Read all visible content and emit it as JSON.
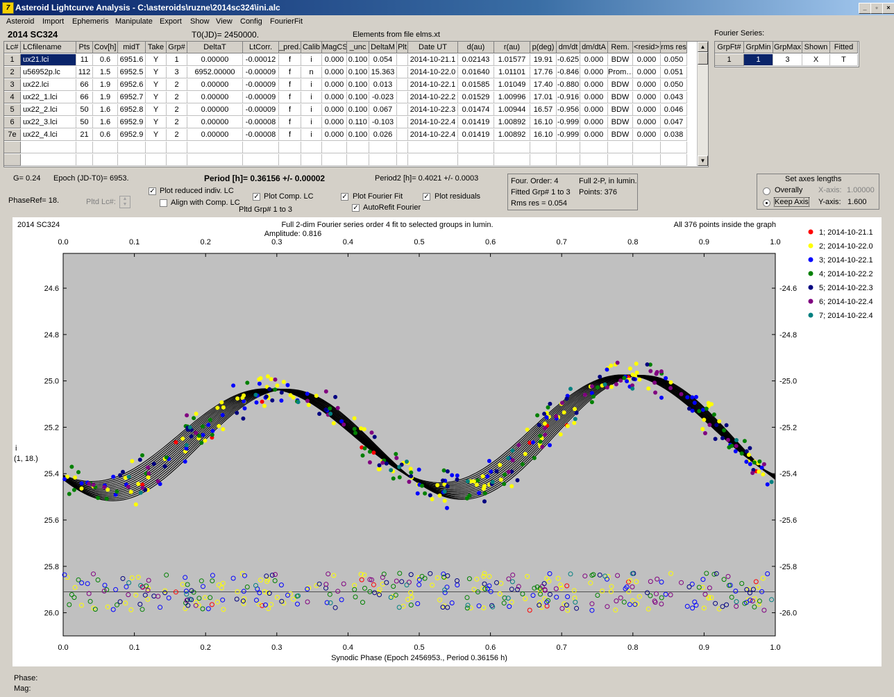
{
  "window": {
    "title": "Asteroid Lightcurve Analysis - C:\\asteroids\\ruzne\\2014sc324\\ini.alc",
    "icon": "app-icon",
    "min": "_",
    "max": "▫",
    "close": "×"
  },
  "menu": [
    "Asteroid",
    "Import",
    "Ephemeris",
    "Manipulate",
    "Export",
    "Show",
    "View",
    "Config",
    "FourierFit"
  ],
  "header": {
    "asteroid": "2014 SC324",
    "t0": "T0(JD)= 2450000.",
    "elements": "Elements from file elms.xt"
  },
  "table": {
    "columns": [
      "Lc#",
      "LCfilename",
      "Pts",
      "Cov[h]",
      "midT",
      "Take",
      "Grp#",
      "DeltaT",
      "LtCorr.",
      "_pred.",
      "Calib",
      "MagCS",
      "_unc",
      "DeltaM",
      "Plt",
      "Date UT",
      "d(au)",
      "r(au)",
      "p(deg)",
      "dm/dt",
      "dm/dtA",
      "Rem.",
      "<resid>",
      "rms res"
    ],
    "rows": [
      [
        "1",
        "ux21.lci",
        "11",
        "0.6",
        "6951.6",
        "Y",
        "1",
        "0.00000",
        "-0.00012",
        "f",
        "i",
        "0.000",
        "0.100",
        "0.054",
        "",
        "2014-10-21.1",
        "0.02143",
        "1.01577",
        "19.91",
        "-0.625",
        "0.000",
        "BDW",
        "0.000",
        "0.050"
      ],
      [
        "2",
        "u56952p.lc",
        "112",
        "1.5",
        "6952.5",
        "Y",
        "3",
        "6952.00000",
        "-0.00009",
        "f",
        "n",
        "0.000",
        "0.100",
        "15.363",
        "",
        "2014-10-22.0",
        "0.01640",
        "1.01101",
        "17.76",
        "-0.846",
        "0.000",
        "Prom…",
        "0.000",
        "0.051"
      ],
      [
        "3",
        "ux22.lci",
        "66",
        "1.9",
        "6952.6",
        "Y",
        "2",
        "0.00000",
        "-0.00009",
        "f",
        "i",
        "0.000",
        "0.100",
        "0.013",
        "",
        "2014-10-22.1",
        "0.01585",
        "1.01049",
        "17.40",
        "-0.880",
        "0.000",
        "BDW",
        "0.000",
        "0.050"
      ],
      [
        "4",
        "ux22_1.lci",
        "66",
        "1.9",
        "6952.7",
        "Y",
        "2",
        "0.00000",
        "-0.00009",
        "f",
        "i",
        "0.000",
        "0.100",
        "-0.023",
        "",
        "2014-10-22.2",
        "0.01529",
        "1.00996",
        "17.01",
        "-0.916",
        "0.000",
        "BDW",
        "0.000",
        "0.043"
      ],
      [
        "5",
        "ux22_2.lci",
        "50",
        "1.6",
        "6952.8",
        "Y",
        "2",
        "0.00000",
        "-0.00009",
        "f",
        "i",
        "0.000",
        "0.100",
        "0.067",
        "",
        "2014-10-22.3",
        "0.01474",
        "1.00944",
        "16.57",
        "-0.956",
        "0.000",
        "BDW",
        "0.000",
        "0.046"
      ],
      [
        "6",
        "ux22_3.lci",
        "50",
        "1.6",
        "6952.9",
        "Y",
        "2",
        "0.00000",
        "-0.00008",
        "f",
        "i",
        "0.000",
        "0.110",
        "-0.103",
        "",
        "2014-10-22.4",
        "0.01419",
        "1.00892",
        "16.10",
        "-0.999",
        "0.000",
        "BDW",
        "0.000",
        "0.047"
      ],
      [
        "7e",
        "ux22_4.lci",
        "21",
        "0.6",
        "6952.9",
        "Y",
        "2",
        "0.00000",
        "-0.00008",
        "f",
        "i",
        "0.000",
        "0.100",
        "0.026",
        "",
        "2014-10-22.4",
        "0.01419",
        "1.00892",
        "16.10",
        "-0.999",
        "0.000",
        "BDW",
        "0.000",
        "0.038"
      ]
    ]
  },
  "fourier": {
    "title": "Fourier Series:",
    "columns": [
      "GrpFt#",
      "GrpMin",
      "GrpMax",
      "Shown",
      "Fitted"
    ],
    "row": [
      "1",
      "1",
      "3",
      "X",
      "T"
    ]
  },
  "controls": {
    "g": "G= 0.24",
    "epoch": "Epoch (JD-T0)= 6953.",
    "period": "Period [h]= 0.36156 +/- 0.00002",
    "period2": "Period2 [h]= 0.4021 +/- 0.0003",
    "phaseref": "PhaseRef= 18.",
    "pltd_lc": "Pltd Lc#:",
    "plot_reduced": "Plot reduced indiv. LC",
    "align": "Align with Comp. LC",
    "plot_comp": "Plot Comp. LC",
    "plot_fourier": "Plot Fourier Fit",
    "plot_resid": "Plot residuals",
    "autorefit": "AutoRefit Fourier",
    "pltd_grp": "Pltd Grp#  1   to   3",
    "info_order": "Four. Order:  4",
    "info_full": "Full 2-P, in lumin.",
    "info_fitted": "Fitted Grp# 1 to 3",
    "info_points": "Points: 376",
    "info_rms": "Rms res     = 0.054",
    "axes_title": "Set axes lengths",
    "overally": "Overally",
    "keep_axis": "Keep Axis",
    "xaxis_lbl": "X-axis:",
    "xaxis_val": "1.00000",
    "yaxis_lbl": "Y-axis:",
    "yaxis_val": "1.600"
  },
  "status": {
    "phase": "Phase:",
    "mag": "Mag:"
  },
  "chart_data": {
    "type": "scatter",
    "title": "2014 SC324",
    "subtitle": "Full 2-dim Fourier series order 4 fit to selected groups in lumin.",
    "amplitude": "Amplitude: 0.816",
    "note": "All 376 points inside the graph",
    "xlabel": "Synodic Phase (Epoch 2456953., Period 0.36156 h)",
    "ylabel": "i",
    "ylabel2": "(1, 18.)",
    "xlim": [
      0.0,
      1.0
    ],
    "ylim": [
      24.45,
      26.1
    ],
    "y_inverted": true,
    "xticks": [
      "0.0",
      "0.1",
      "0.2",
      "0.3",
      "0.4",
      "0.5",
      "0.6",
      "0.7",
      "0.8",
      "0.9",
      "1.0"
    ],
    "yticks": [
      "24.6",
      "24.8",
      "25.0",
      "25.2",
      "25.4",
      "25.6",
      "25.8",
      "26.0"
    ],
    "residual_baseline": 25.91,
    "series": [
      {
        "name": "1; 2014-10-21.1",
        "color": "#ff0000"
      },
      {
        "name": "2; 2014-10-22.0",
        "color": "#ffff00"
      },
      {
        "name": "3; 2014-10-22.1",
        "color": "#0000ff"
      },
      {
        "name": "4; 2014-10-22.2",
        "color": "#008000"
      },
      {
        "name": "5; 2014-10-22.3",
        "color": "#000080"
      },
      {
        "name": "6; 2014-10-22.4",
        "color": "#800080"
      },
      {
        "name": "7; 2014-10-22.4",
        "color": "#008080"
      }
    ],
    "fourier_fit": {
      "mean": 25.24,
      "a1": 0.235,
      "phase1": 0.05,
      "a2": 0.03,
      "phase2": 0.3
    }
  }
}
